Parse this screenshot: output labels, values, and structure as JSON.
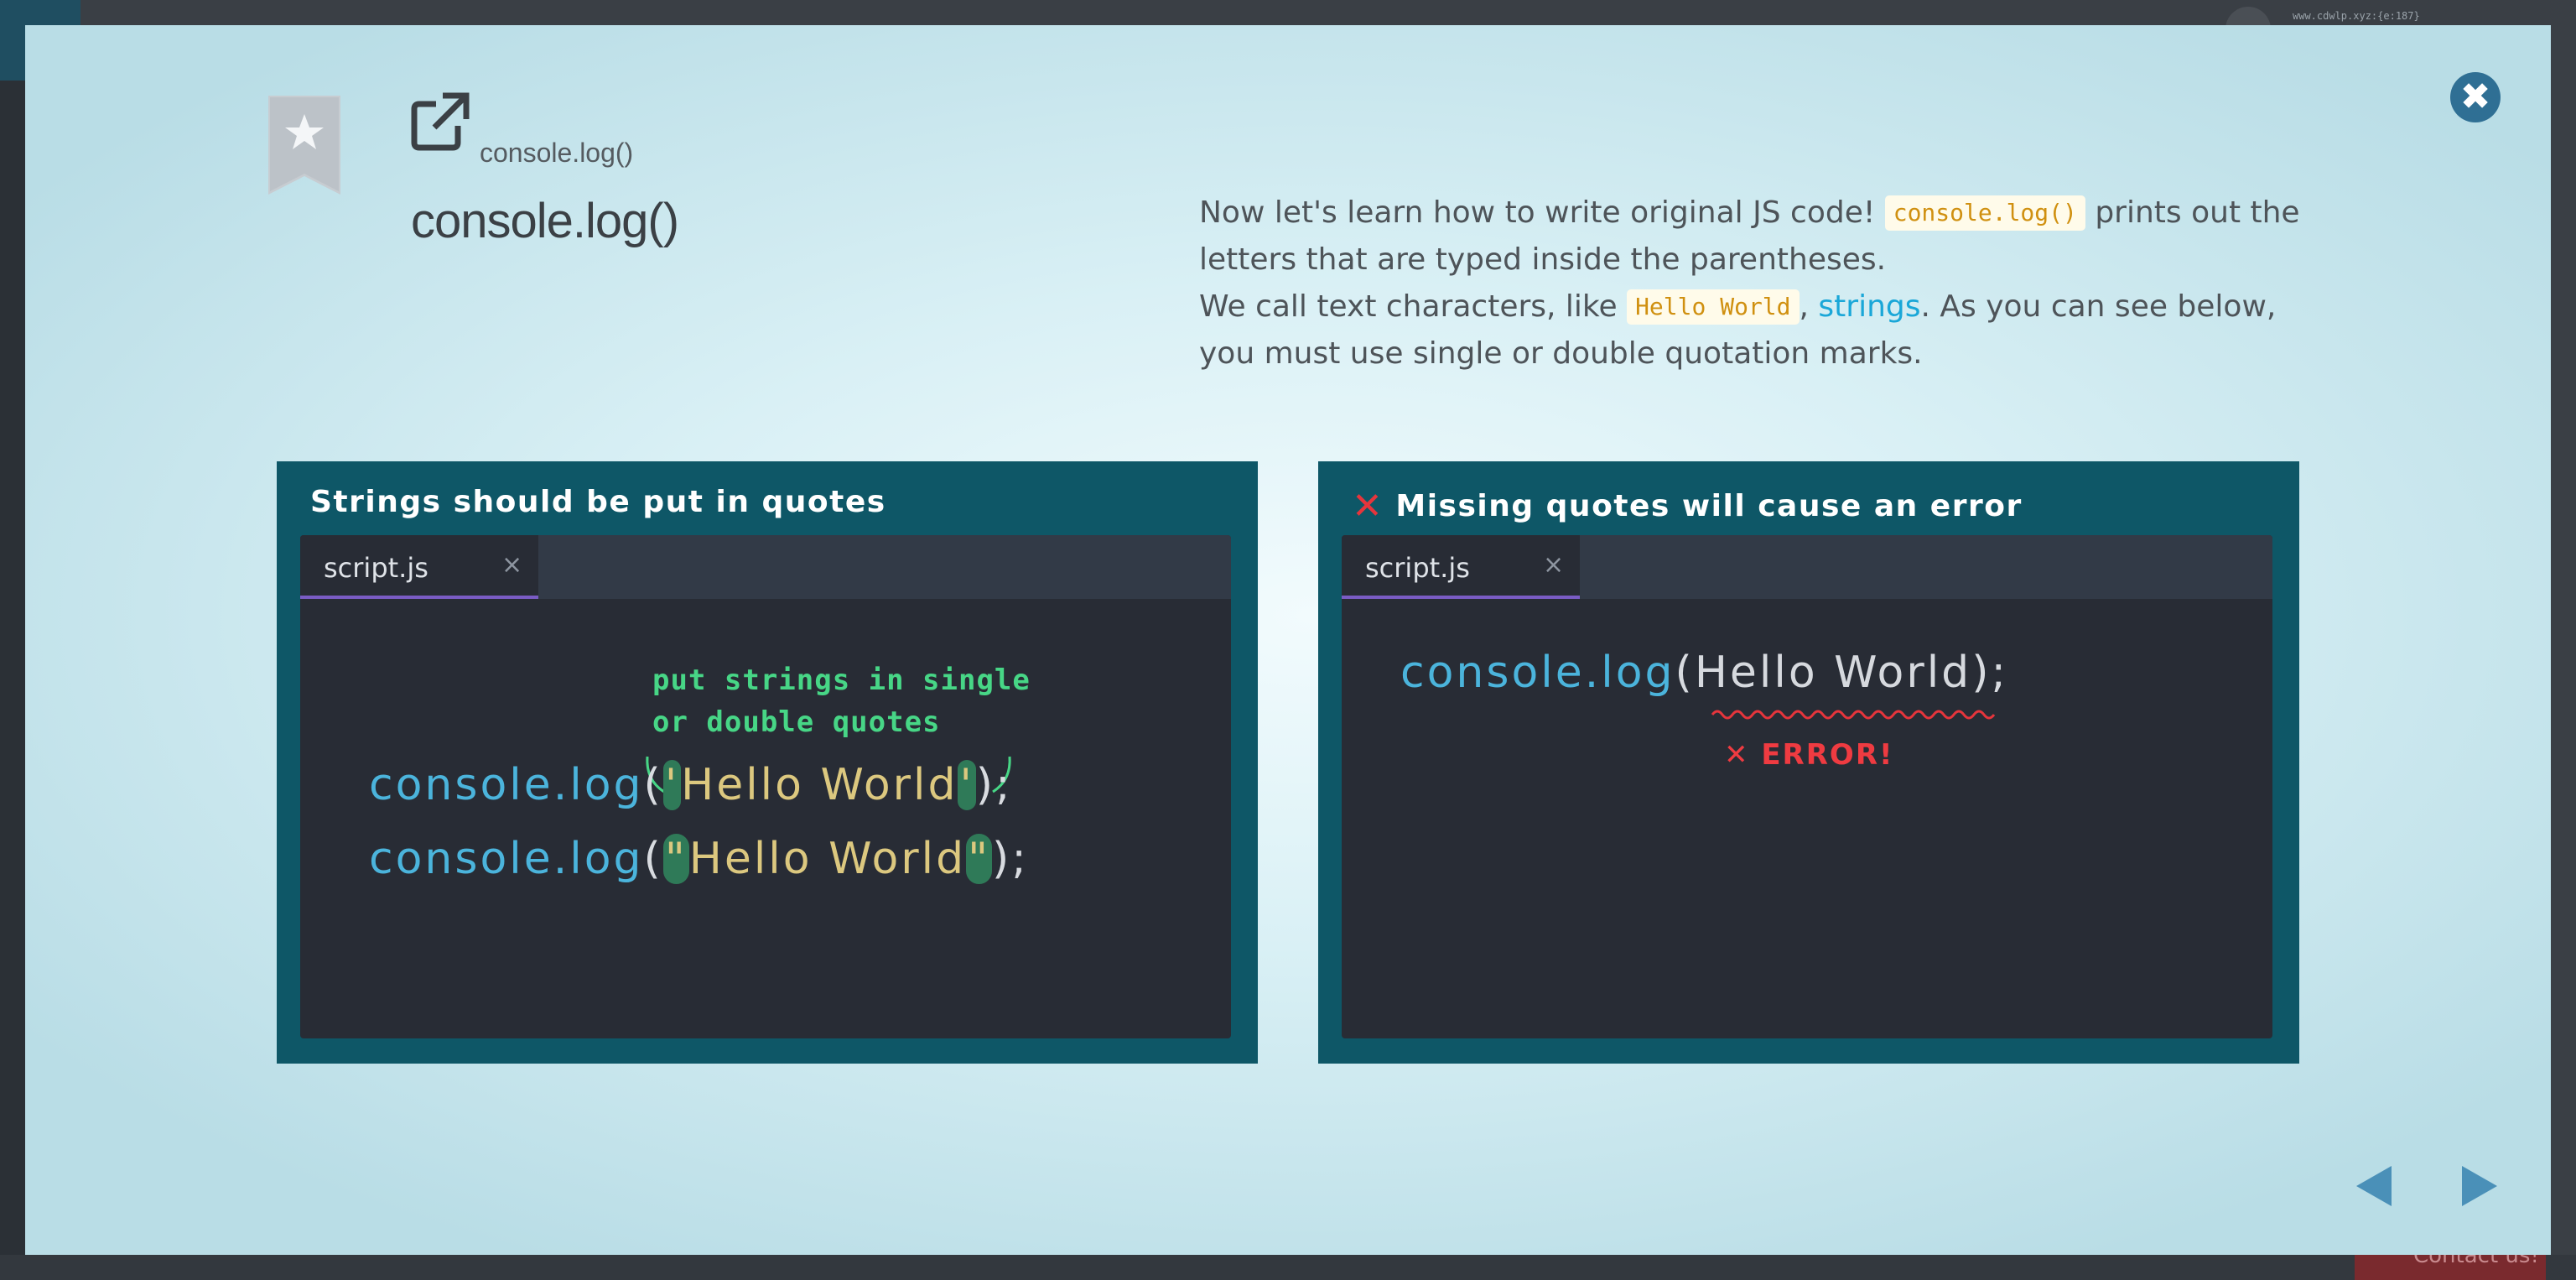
{
  "background": {
    "url_text": "www.cdwlp.xyz:{e:187}",
    "contact_label": "Contact us!"
  },
  "modal": {
    "breadcrumb": "console.log()",
    "title": "console.log()",
    "intro": {
      "p1_a": "Now let's learn how to write original JS code! ",
      "p1_code": "console.log()",
      "p1_b": " prints out the letters that are typed inside the parentheses.",
      "p2_a": "We call text characters, like ",
      "p2_code": "Hello World",
      "p2_sep": ", ",
      "p2_term": "strings",
      "p2_b": ". As you can see below, you must use single or double quotation marks."
    }
  },
  "panels": {
    "left": {
      "title": "Strings should be put in quotes",
      "tab": "script.js",
      "annotation_line1": "put strings in single",
      "annotation_line2": "or double quotes",
      "line1": {
        "obj": "console",
        "dot": ".",
        "fn": "log",
        "open": "(",
        "q1": "'",
        "str": "Hello World",
        "q2": "'",
        "close": ");"
      },
      "line2": {
        "obj": "console",
        "dot": ".",
        "fn": "log",
        "open": "(",
        "q1": "\"",
        "str": "Hello World",
        "q2": "\"",
        "close": ");"
      }
    },
    "right": {
      "title": "Missing quotes will cause an error",
      "tab": "script.js",
      "line1": {
        "obj": "console",
        "dot": ".",
        "fn": "log",
        "open": "(",
        "arg": "Hello World",
        "close": ");"
      },
      "error_label": "ERROR!"
    }
  },
  "colors": {
    "panel_bg": "#0e5767",
    "editor_bg": "#282c35",
    "code_keyword": "#4bb4dc",
    "code_string": "#dcc87f",
    "annotation": "#47d686",
    "error": "#ef3b41",
    "tab_underline": "#7a5cc4",
    "close_button": "#2f6f94"
  },
  "icons": {
    "close": "close-circle-icon",
    "bookmark": "bookmark-star-icon",
    "external": "external-link-icon",
    "prev": "arrow-left-icon",
    "next": "arrow-right-icon",
    "error": "x-mark-icon"
  }
}
